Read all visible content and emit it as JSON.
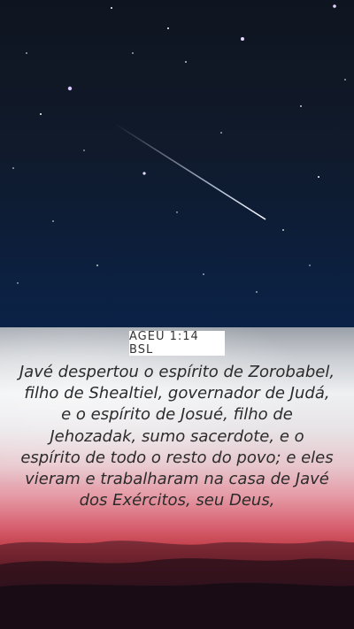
{
  "wallpaper": {
    "reference": "AGEU 1:14 BSL",
    "verse_text": "Javé despertou o espírito de Zorobabel, filho de Shealtiel, governador de Judá, e o espírito de Josué, filho de Jehozadak, sumo sacerdote, e o espírito de todo o resto do povo; e eles vieram e trabalharam na casa de Javé dos Exércitos, seu Deus,"
  },
  "colors": {
    "night_sky": "#0f1520",
    "night_sky_horizon": "#0b2247",
    "sunset_red": "#d86170",
    "verse_text": "#2b2b2b",
    "badge_background": "#ffffff"
  }
}
